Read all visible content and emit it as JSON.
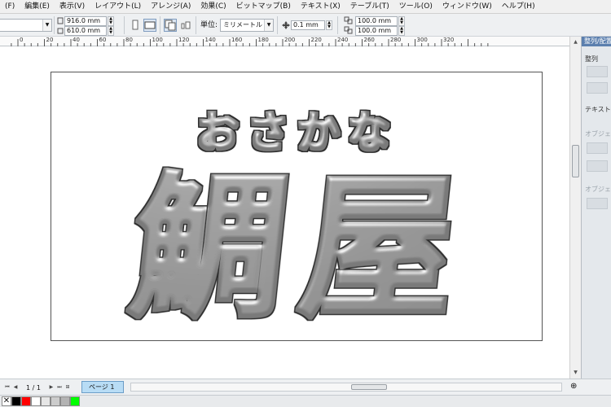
{
  "menu": {
    "items": [
      "(F)",
      "編集(E)",
      "表示(V)",
      "レイアウト(L)",
      "アレンジ(A)",
      "効果(C)",
      "ビットマップ(B)",
      "テキスト(X)",
      "テーブル(T)",
      "ツール(O)",
      "ウィンドウ(W)",
      "ヘルプ(H)"
    ]
  },
  "propbar": {
    "width": "916.0 mm",
    "height": "610.0 mm",
    "units_label": "単位:",
    "units_value": "ミリメートル",
    "nudge": "0.1 mm",
    "dup_x": "100.0 mm",
    "dup_y": "100.0 mm"
  },
  "ruler": {
    "labels": [
      "0",
      "20",
      "40",
      "60",
      "80",
      "100",
      "120",
      "140",
      "160",
      "180",
      "200",
      "220",
      "240",
      "260",
      "280",
      "300",
      "320"
    ]
  },
  "docker": {
    "title": "整列/配置",
    "align_label": "整列",
    "text_label": "テキスト",
    "object_label": "オブジェクト",
    "object_label2": "オブジェク"
  },
  "canvas": {
    "heading": "おさかな",
    "main_text": "鯛屋",
    "colors": {
      "art_fill": "#888888",
      "art_edge": "#3a3a3a"
    }
  },
  "bottom": {
    "page_counter": "1 / 1",
    "page_tab": "ページ 1"
  },
  "palette": {
    "colors": [
      "#000000",
      "#ff0000",
      "#ffffff",
      "#e6e6e6",
      "#cccccc",
      "#b3b3b3",
      "#00ff00"
    ]
  }
}
